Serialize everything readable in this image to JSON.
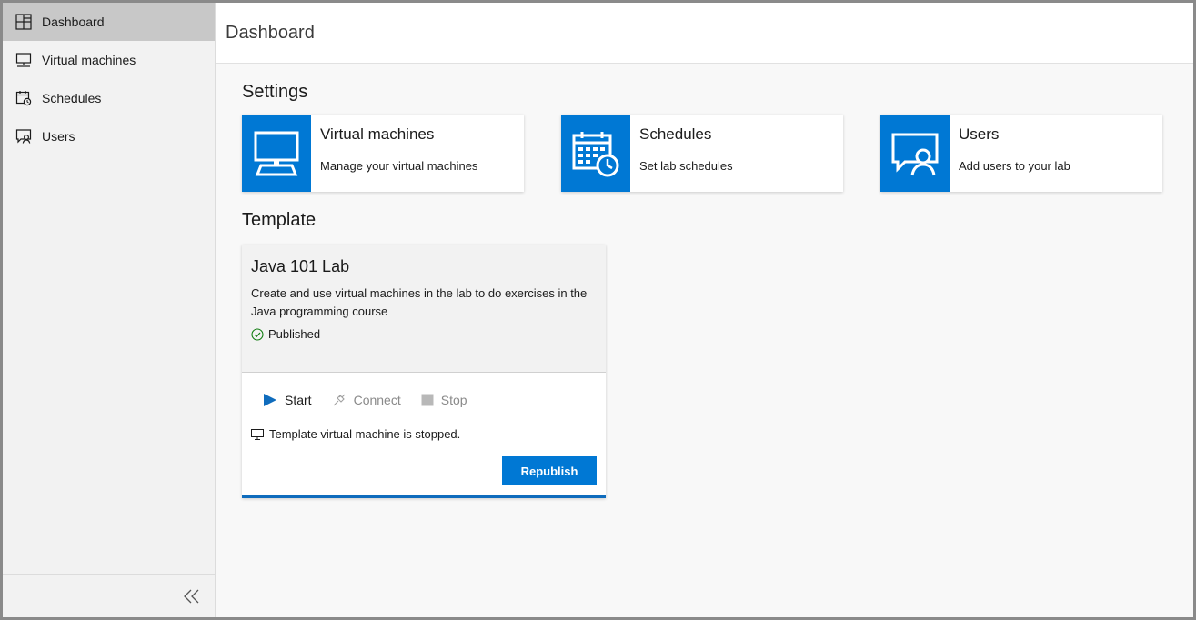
{
  "sidebar": {
    "items": [
      {
        "label": "Dashboard",
        "icon": "dashboard-icon",
        "active": true
      },
      {
        "label": "Virtual machines",
        "icon": "monitor-icon",
        "active": false
      },
      {
        "label": "Schedules",
        "icon": "calendar-clock-icon",
        "active": false
      },
      {
        "label": "Users",
        "icon": "users-icon",
        "active": false
      }
    ],
    "collapse_icon": "double-chevron-left-icon"
  },
  "header": {
    "title": "Dashboard"
  },
  "settings": {
    "title": "Settings",
    "cards": [
      {
        "title": "Virtual machines",
        "desc": "Manage your virtual machines",
        "icon": "monitor-icon"
      },
      {
        "title": "Schedules",
        "desc": "Set lab schedules",
        "icon": "calendar-clock-icon"
      },
      {
        "title": "Users",
        "desc": "Add users to your lab",
        "icon": "users-icon"
      }
    ]
  },
  "template": {
    "title": "Template",
    "name": "Java 101 Lab",
    "desc": "Create and use virtual machines in the lab to do exercises in the Java programming course",
    "status": "Published",
    "actions": {
      "start": "Start",
      "connect": "Connect",
      "stop": "Stop"
    },
    "vm_state": "Template virtual machine is stopped.",
    "republish": "Republish"
  },
  "colors": {
    "accent": "#0078d4",
    "published": "#107c10"
  }
}
